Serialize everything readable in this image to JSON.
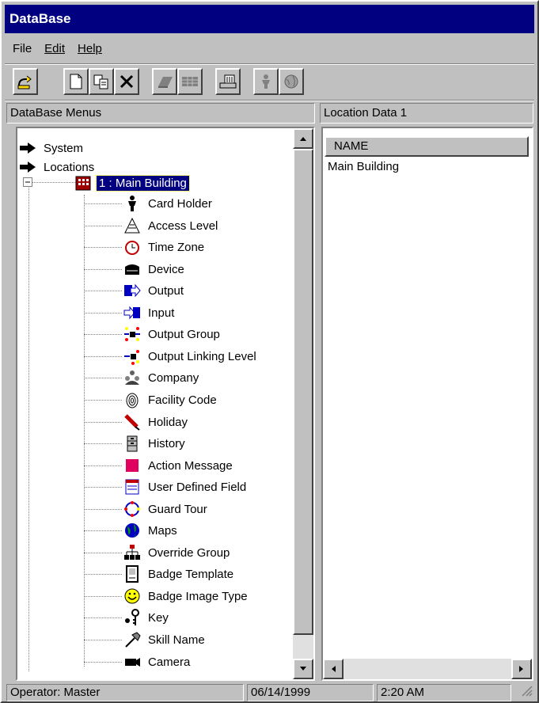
{
  "window": {
    "title": "DataBase"
  },
  "menu": [
    {
      "label": "File"
    },
    {
      "label": "Edit"
    },
    {
      "label": "Help"
    }
  ],
  "toolbar": {
    "buttons": [
      {
        "icon": "exit-icon"
      },
      {
        "icon": "new-icon"
      },
      {
        "icon": "copy-icon"
      },
      {
        "icon": "delete-icon"
      },
      {
        "icon": "eraser-icon",
        "disabled": true
      },
      {
        "icon": "grid-icon",
        "disabled": true
      },
      {
        "icon": "keyboard-icon"
      },
      {
        "icon": "person-icon",
        "disabled": true
      },
      {
        "icon": "globe-icon",
        "disabled": true
      }
    ]
  },
  "left_panel": {
    "header": "DataBase Menus"
  },
  "right_panel": {
    "header": "Location Data  1",
    "column": "NAME",
    "rows": [
      "Main Building"
    ]
  },
  "tree": {
    "roots": [
      {
        "label": "System",
        "icon": "arrow-right-icon"
      },
      {
        "label": "Locations",
        "icon": "arrow-right-icon"
      }
    ],
    "selected": {
      "label": "1 : Main Building",
      "icon": "building-icon"
    },
    "children": [
      {
        "label": "Card Holder",
        "icon": "card-holder-icon"
      },
      {
        "label": "Access Level",
        "icon": "access-level-icon"
      },
      {
        "label": "Time Zone",
        "icon": "clock-icon"
      },
      {
        "label": "Device",
        "icon": "device-icon"
      },
      {
        "label": "Output",
        "icon": "output-icon"
      },
      {
        "label": "Input",
        "icon": "input-icon"
      },
      {
        "label": "Output Group",
        "icon": "output-group-icon"
      },
      {
        "label": "Output Linking Level",
        "icon": "output-linking-icon"
      },
      {
        "label": "Company",
        "icon": "company-icon"
      },
      {
        "label": "Facility Code",
        "icon": "fingerprint-icon"
      },
      {
        "label": "Holiday",
        "icon": "holiday-icon"
      },
      {
        "label": "History",
        "icon": "history-icon"
      },
      {
        "label": "Action Message",
        "icon": "action-message-icon"
      },
      {
        "label": "User Defined Field",
        "icon": "user-field-icon"
      },
      {
        "label": "Guard Tour",
        "icon": "guard-tour-icon"
      },
      {
        "label": "Maps",
        "icon": "globe-icon"
      },
      {
        "label": "Override Group",
        "icon": "override-group-icon"
      },
      {
        "label": "Badge Template",
        "icon": "badge-template-icon"
      },
      {
        "label": "Badge Image Type",
        "icon": "smiley-icon"
      },
      {
        "label": "Key",
        "icon": "key-icon"
      },
      {
        "label": "Skill Name",
        "icon": "hammer-icon"
      },
      {
        "label": "Camera",
        "icon": "camera-icon"
      }
    ]
  },
  "status": {
    "operator": "Operator:  Master",
    "date": "06/14/1999",
    "time": "2:20 AM"
  }
}
